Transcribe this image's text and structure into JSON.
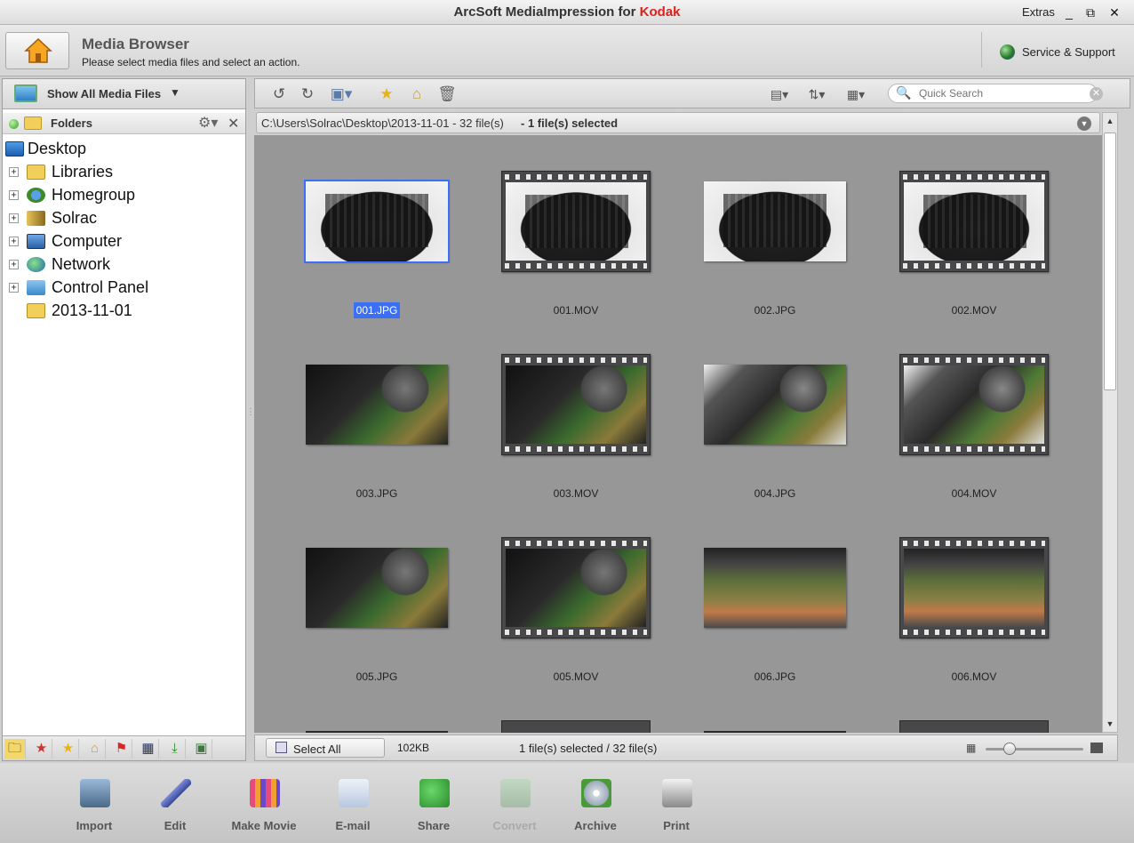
{
  "window": {
    "title_prefix": "ArcSoft MediaImpression for ",
    "title_brand": "Kodak",
    "extras": "Extras",
    "minimize": "_",
    "restore": "⧉",
    "close": "✕"
  },
  "header": {
    "title": "Media Browser",
    "subtitle": "Please select media files and select an action.",
    "support": "Service & Support"
  },
  "left": {
    "filter": "Show All Media Files",
    "panel_title": "Folders",
    "tree": [
      {
        "label": "Desktop"
      },
      {
        "label": "Libraries"
      },
      {
        "label": "Homegroup"
      },
      {
        "label": "Solrac"
      },
      {
        "label": "Computer"
      },
      {
        "label": "Network"
      },
      {
        "label": "Control Panel"
      },
      {
        "label": "2013-11-01"
      }
    ]
  },
  "search": {
    "placeholder": "Quick Search"
  },
  "path": {
    "location": "C:\\Users\\Solrac\\Desktop\\2013-11-01 - 32 file(s)",
    "selection": "- 1 file(s) selected"
  },
  "files": [
    {
      "name": "001.JPG",
      "type": "image",
      "look": "case",
      "selected": true
    },
    {
      "name": "001.MOV",
      "type": "movie",
      "look": "case"
    },
    {
      "name": "002.JPG",
      "type": "image",
      "look": "case"
    },
    {
      "name": "002.MOV",
      "type": "movie",
      "look": "case"
    },
    {
      "name": "003.JPG",
      "type": "image",
      "look": "board"
    },
    {
      "name": "003.MOV",
      "type": "movie",
      "look": "board"
    },
    {
      "name": "004.JPG",
      "type": "image",
      "look": "board-light"
    },
    {
      "name": "004.MOV",
      "type": "movie",
      "look": "board-light"
    },
    {
      "name": "005.JPG",
      "type": "image",
      "look": "board"
    },
    {
      "name": "005.MOV",
      "type": "movie",
      "look": "board"
    },
    {
      "name": "006.JPG",
      "type": "image",
      "look": "pcb"
    },
    {
      "name": "006.MOV",
      "type": "movie",
      "look": "pcb"
    }
  ],
  "status": {
    "select_all": "Select All",
    "size": "102KB",
    "count": "1 file(s) selected / 32 file(s)"
  },
  "actions": [
    {
      "label": "Import",
      "icon": "import-icon",
      "enabled": true
    },
    {
      "label": "Edit",
      "icon": "edit-brush-icon",
      "enabled": true
    },
    {
      "label": "Make Movie",
      "icon": "make-movie-icon",
      "enabled": true
    },
    {
      "label": "E-mail",
      "icon": "email-envelope-icon",
      "enabled": true
    },
    {
      "label": "Share",
      "icon": "share-icon",
      "enabled": true
    },
    {
      "label": "Convert",
      "icon": "convert-icon",
      "enabled": false
    },
    {
      "label": "Archive",
      "icon": "archive-disc-icon",
      "enabled": true
    },
    {
      "label": "Print",
      "icon": "printer-icon",
      "enabled": true
    }
  ],
  "colors": {
    "brand": "#e0201a",
    "selection": "#3b6ff5",
    "grid_bg": "#979797"
  }
}
